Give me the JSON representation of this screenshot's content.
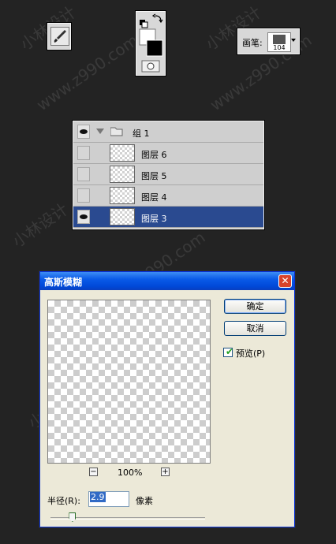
{
  "watermarks": {
    "w1": "小林设计",
    "w2": "www.z990.com",
    "w3": "小林设计",
    "w4": "www.z990.com",
    "w5": "小林设计",
    "w6": "www.z990.com",
    "w7": "小林设计",
    "w8": "www.z990.com"
  },
  "brush_options": {
    "label": "画笔:",
    "size": "104"
  },
  "layers": {
    "group_name": "组 1",
    "items": [
      {
        "name": "图层 6",
        "visible": false,
        "selected": false
      },
      {
        "name": "图层 5",
        "visible": false,
        "selected": false
      },
      {
        "name": "图层 4",
        "visible": false,
        "selected": false
      },
      {
        "name": "图层 3",
        "visible": true,
        "selected": true
      }
    ]
  },
  "dialog": {
    "title": "高斯模糊",
    "close": "✕",
    "ok_label": "确定",
    "cancel_label": "取消",
    "preview_label": "预览(P)",
    "preview_checked": true,
    "zoom_out": "−",
    "zoom_in": "+",
    "zoom_value": "100%",
    "radius_label": "半径(R):",
    "radius_value": "2.9",
    "unit_label": "像素",
    "slider_level": 0.14
  },
  "colors": {
    "title_bar": "#0a5ae8",
    "selected_layer": "#2a4a90",
    "background": "#232323"
  }
}
